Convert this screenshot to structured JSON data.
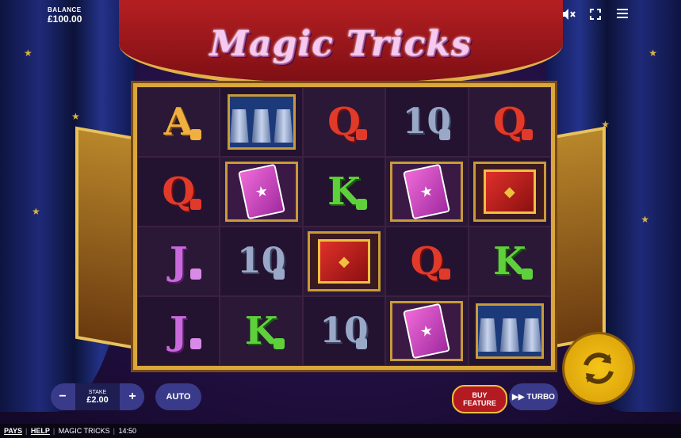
{
  "game": {
    "title": "Magic Tricks",
    "balance_label": "BALANCE",
    "balance_value": "£100.00"
  },
  "top_icons": [
    "mute-icon",
    "fullscreen-icon",
    "menu-icon"
  ],
  "reels": [
    [
      "A",
      "Q",
      "J",
      "J"
    ],
    [
      "cups",
      "cards",
      "10",
      "K"
    ],
    [
      "Q",
      "K",
      "box",
      "10"
    ],
    [
      "10",
      "cards",
      "Q",
      "cards"
    ],
    [
      "Q",
      "box",
      "K",
      "cups"
    ]
  ],
  "controls": {
    "stake_label": "STAKE",
    "stake_value": "£2.00",
    "minus": "−",
    "plus": "+",
    "auto": "AUTO",
    "buy_line1": "BUY",
    "buy_line2": "FEATURE",
    "turbo": "TURBO"
  },
  "footer": {
    "pays": "PAYS",
    "help": "HELP",
    "game_name": "MAGIC TRICKS",
    "time": "14:50"
  },
  "colors": {
    "frame_gold": "#d9a73c",
    "spin_yellow": "#f5c518",
    "banner_red": "#b51f22"
  }
}
